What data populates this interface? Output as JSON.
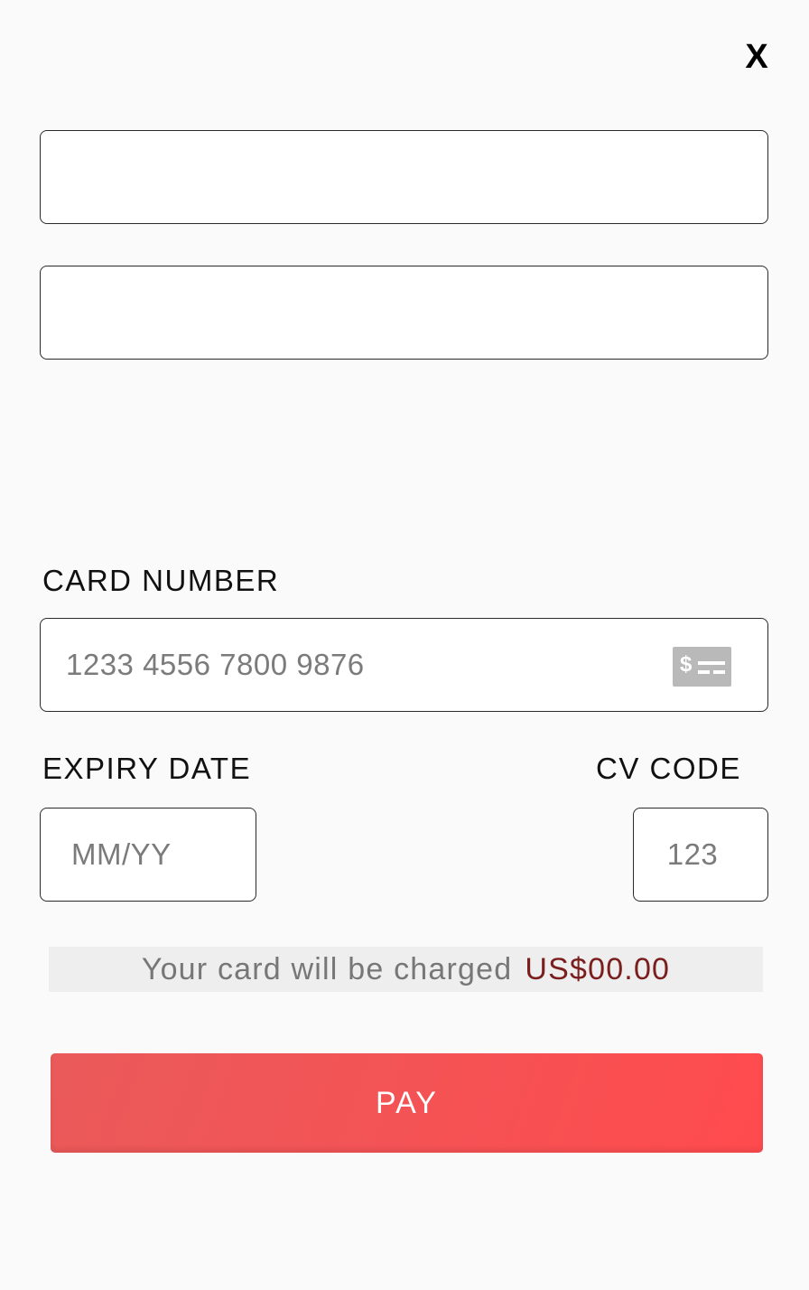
{
  "close": {
    "label": "X"
  },
  "fields": {
    "field_1": {
      "value": "",
      "placeholder": ""
    },
    "field_2": {
      "value": "",
      "placeholder": ""
    }
  },
  "card_number": {
    "label": "CARD NUMBER",
    "placeholder": "1233 4556 7800 9876",
    "icon": "credit-card-icon",
    "icon_symbol": "$"
  },
  "expiry": {
    "label": "EXPIRY DATE",
    "placeholder": "MM/YY"
  },
  "cvc": {
    "label": "CV CODE",
    "placeholder": "123"
  },
  "charge": {
    "text": "Your card will be charged",
    "amount": "US$00.00"
  },
  "pay_button": {
    "label": "PAY"
  },
  "colors": {
    "background": "#fafafa",
    "pay_button": "#f45355",
    "amount": "#7b1e1e",
    "placeholder": "#7b7b7b"
  }
}
